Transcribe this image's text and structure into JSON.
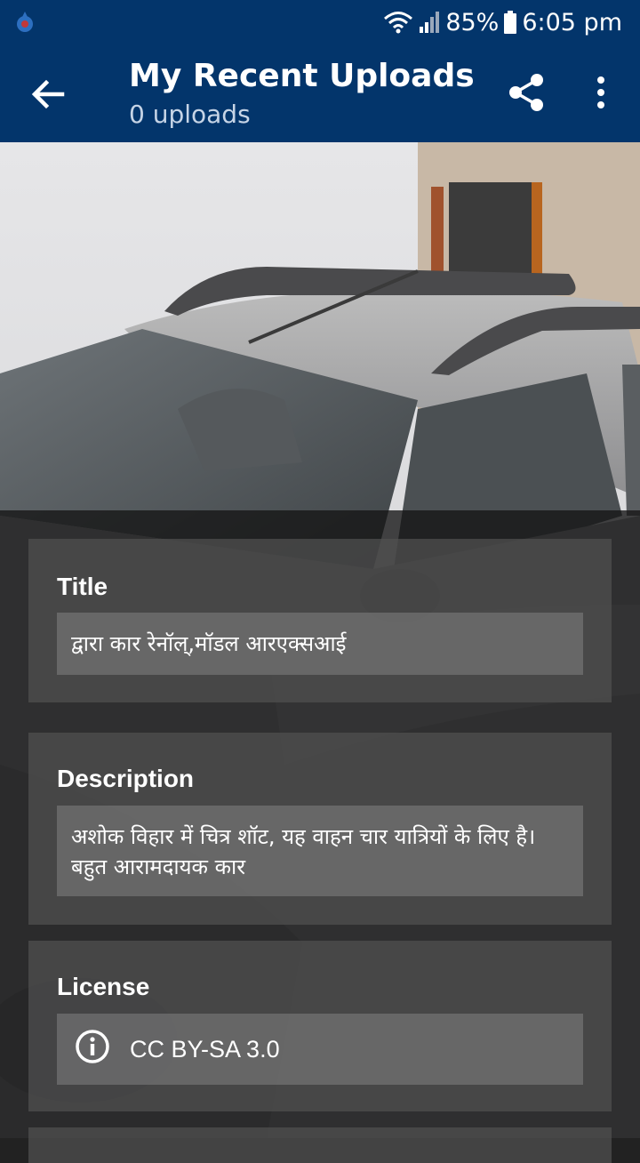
{
  "status_bar": {
    "battery": "85%",
    "time": "6:05 pm",
    "icons": [
      "app-notification-icon",
      "wifi-icon",
      "signal-icon",
      "battery-icon"
    ]
  },
  "app_bar": {
    "title": "My Recent Uploads",
    "subtitle": "0 uploads",
    "icons": [
      "back-arrow-icon",
      "share-icon",
      "more-vert-icon"
    ],
    "color": "#03356b"
  },
  "details": {
    "title_label": "Title",
    "title_value": "द्वारा कार रेनॉल्,मॉडल आरएक्सआई",
    "description_label": "Description",
    "description_value": "अशोक विहार में चित्र शॉट, यह वाहन चार यात्रियों के लिए है। बहुत आरामदायक कार",
    "license_label": "License",
    "license_value": "CC BY-SA 3.0",
    "license_icon": "info-icon"
  }
}
